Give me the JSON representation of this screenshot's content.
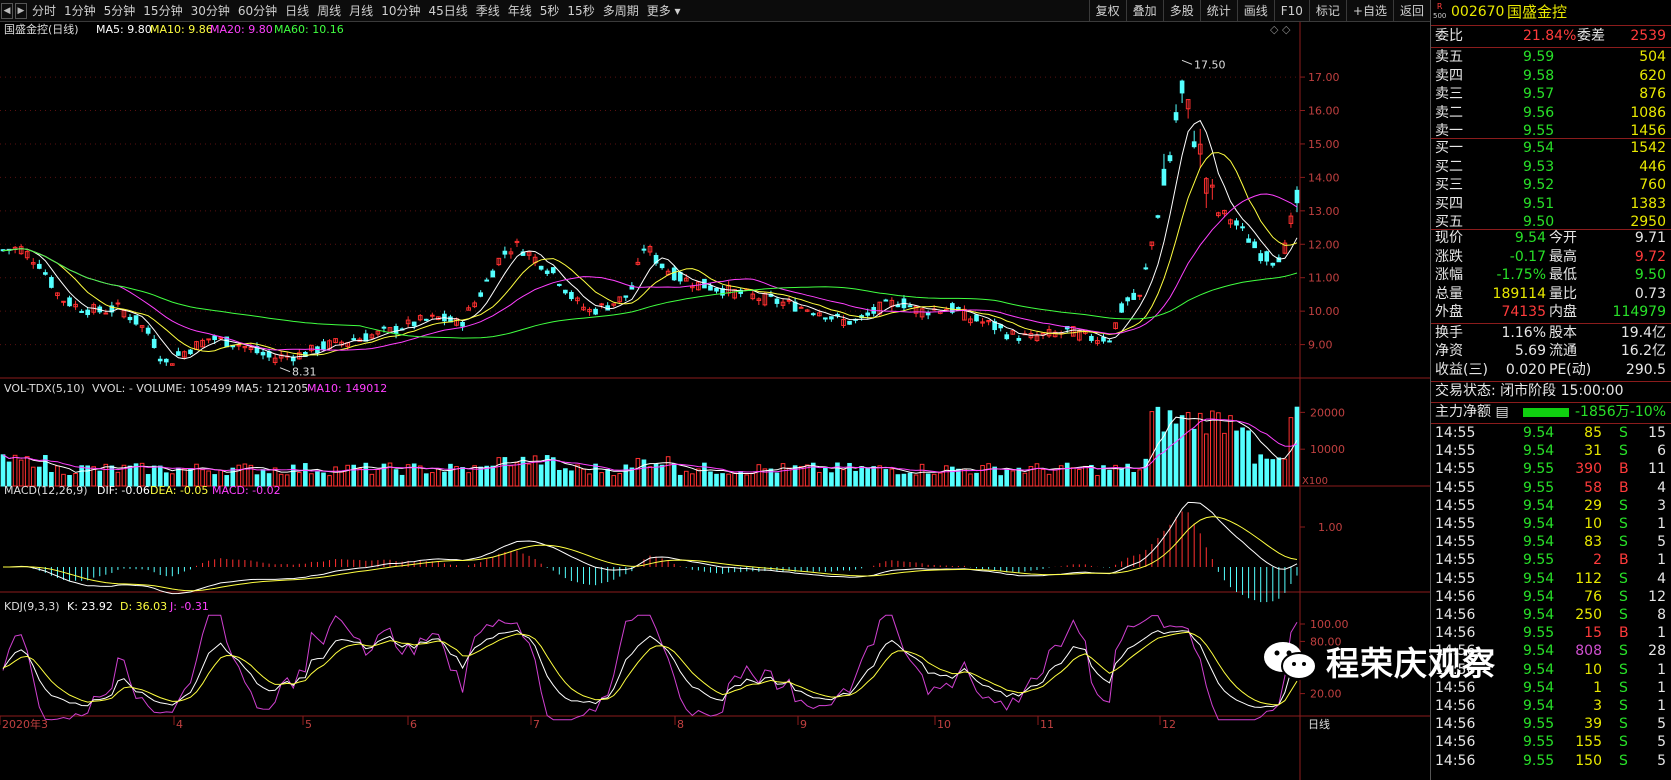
{
  "toolbar": {
    "periods": [
      "分时",
      "1分钟",
      "5分钟",
      "15分钟",
      "30分钟",
      "60分钟",
      "日线",
      "周线",
      "月线",
      "10分钟",
      "45日线",
      "季线",
      "年线",
      "5秒",
      "15秒",
      "多周期",
      "更多"
    ],
    "buttons": [
      "复权",
      "叠加",
      "多股",
      "统计",
      "画线",
      "F10",
      "标记",
      "+自选",
      "返回"
    ]
  },
  "main": {
    "title": "国盛金控(日线)",
    "ma5": "MA5: 9.80",
    "ma10": "MA10: 9.86",
    "ma20": "MA20: 9.80",
    "ma60": "MA60: 10.16",
    "high_mark": "17.50",
    "low_mark": "8.31",
    "yticks": [
      "17.00",
      "16.00",
      "15.00",
      "14.00",
      "13.00",
      "12.00",
      "11.00",
      "10.00",
      "9.00"
    ]
  },
  "vol": {
    "title": "VOL-TDX(5,10)",
    "vvol": "VVOL: - VOLUME: 105499",
    "ma5": "MA5: 121205",
    "ma10": "MA10: 149012",
    "yticks": [
      "20000",
      "10000"
    ],
    "unit": "X100"
  },
  "macd": {
    "title": "MACD(12,26,9)",
    "dif": "DIF: -0.06",
    "dea": "DEA: -0.05",
    "macd": "MACD: -0.02",
    "ytick": "1.00"
  },
  "kdj": {
    "title": "KDJ(9,3,3)",
    "k": "K: 23.92",
    "d": "D: 36.03",
    "j": "J: -0.31",
    "yticks": [
      "100.00",
      "80.00",
      "20.00"
    ]
  },
  "xaxis": {
    "labels": [
      "2020年3",
      "4",
      "5",
      "6",
      "7",
      "8",
      "9",
      "10",
      "11",
      "12"
    ],
    "period_label": "日线"
  },
  "colors": {
    "up": "#ff3030",
    "down": "#54ffff",
    "ma5": "#ffffff",
    "ma10": "#ffff40",
    "ma20": "#ff40ff",
    "ma60": "#40ff40",
    "grid": "#8b1c1c"
  },
  "panel": {
    "code": "002670",
    "name": "国盛金控",
    "r_label": "R",
    "r_sub": "500",
    "weibi_label": "委比",
    "weibi": "21.84%",
    "weicha_label": "委差",
    "weicha": "2539",
    "sell": [
      {
        "label": "卖五",
        "price": "9.59",
        "vol": "504"
      },
      {
        "label": "卖四",
        "price": "9.58",
        "vol": "620"
      },
      {
        "label": "卖三",
        "price": "9.57",
        "vol": "876"
      },
      {
        "label": "卖二",
        "price": "9.56",
        "vol": "1086"
      },
      {
        "label": "卖一",
        "price": "9.55",
        "vol": "1456"
      }
    ],
    "buy": [
      {
        "label": "买一",
        "price": "9.54",
        "vol": "1542"
      },
      {
        "label": "买二",
        "price": "9.53",
        "vol": "446"
      },
      {
        "label": "买三",
        "price": "9.52",
        "vol": "760"
      },
      {
        "label": "买四",
        "price": "9.51",
        "vol": "1383"
      },
      {
        "label": "买五",
        "price": "9.50",
        "vol": "2950"
      }
    ],
    "stats": [
      {
        "l1": "现价",
        "v1": "9.54",
        "l2": "今开",
        "v2": "9.71"
      },
      {
        "l1": "涨跌",
        "v1": "-0.17",
        "l2": "最高",
        "v2": "9.72"
      },
      {
        "l1": "涨幅",
        "v1": "-1.75%",
        "l2": "最低",
        "v2": "9.50"
      },
      {
        "l1": "总量",
        "v1": "189114",
        "l2": "量比",
        "v2": "0.73"
      },
      {
        "l1": "外盘",
        "v1": "74135",
        "l2": "内盘",
        "v2": "114979"
      },
      {
        "l1": "换手",
        "v1": "1.16%",
        "l2": "股本",
        "v2": "19.4亿"
      },
      {
        "l1": "净资",
        "v1": "5.69",
        "l2": "流通",
        "v2": "16.2亿"
      },
      {
        "l1": "收益(三)",
        "v1": "0.020",
        "l2": "PE(动)",
        "v2": "290.5"
      }
    ],
    "trade_status": "交易状态: 闭市阶段 15:00:00",
    "main_net_label": "主力净额",
    "main_net": "-1856万",
    "main_net_pct": "-10%",
    "ticks": [
      {
        "t": "14:55",
        "p": "9.54",
        "v": "85",
        "s": "S",
        "n": "15"
      },
      {
        "t": "14:55",
        "p": "9.54",
        "v": "31",
        "s": "S",
        "n": "6"
      },
      {
        "t": "14:55",
        "p": "9.55",
        "v": "390",
        "s": "B",
        "n": "11"
      },
      {
        "t": "14:55",
        "p": "9.55",
        "v": "58",
        "s": "B",
        "n": "4"
      },
      {
        "t": "14:55",
        "p": "9.54",
        "v": "29",
        "s": "S",
        "n": "3"
      },
      {
        "t": "14:55",
        "p": "9.54",
        "v": "10",
        "s": "S",
        "n": "1"
      },
      {
        "t": "14:55",
        "p": "9.54",
        "v": "83",
        "s": "S",
        "n": "5"
      },
      {
        "t": "14:55",
        "p": "9.55",
        "v": "2",
        "s": "B",
        "n": "1"
      },
      {
        "t": "14:55",
        "p": "9.54",
        "v": "112",
        "s": "S",
        "n": "4"
      },
      {
        "t": "14:56",
        "p": "9.54",
        "v": "76",
        "s": "S",
        "n": "12"
      },
      {
        "t": "14:56",
        "p": "9.54",
        "v": "250",
        "s": "S",
        "n": "8"
      },
      {
        "t": "14:56",
        "p": "9.55",
        "v": "15",
        "s": "B",
        "n": "1"
      },
      {
        "t": "14:56",
        "p": "9.54",
        "v": "808",
        "s": "S",
        "n": "28"
      },
      {
        "t": "14:56",
        "p": "9.54",
        "v": "10",
        "s": "S",
        "n": "1"
      },
      {
        "t": "14:56",
        "p": "9.54",
        "v": "1",
        "s": "S",
        "n": "1"
      },
      {
        "t": "14:56",
        "p": "9.54",
        "v": "3",
        "s": "S",
        "n": "1"
      },
      {
        "t": "14:56",
        "p": "9.55",
        "v": "39",
        "s": "S",
        "n": "5"
      },
      {
        "t": "14:56",
        "p": "9.55",
        "v": "155",
        "s": "S",
        "n": "5"
      },
      {
        "t": "14:56",
        "p": "9.55",
        "v": "150",
        "s": "S",
        "n": "5"
      }
    ]
  },
  "watermark": "程荣庆观察"
}
